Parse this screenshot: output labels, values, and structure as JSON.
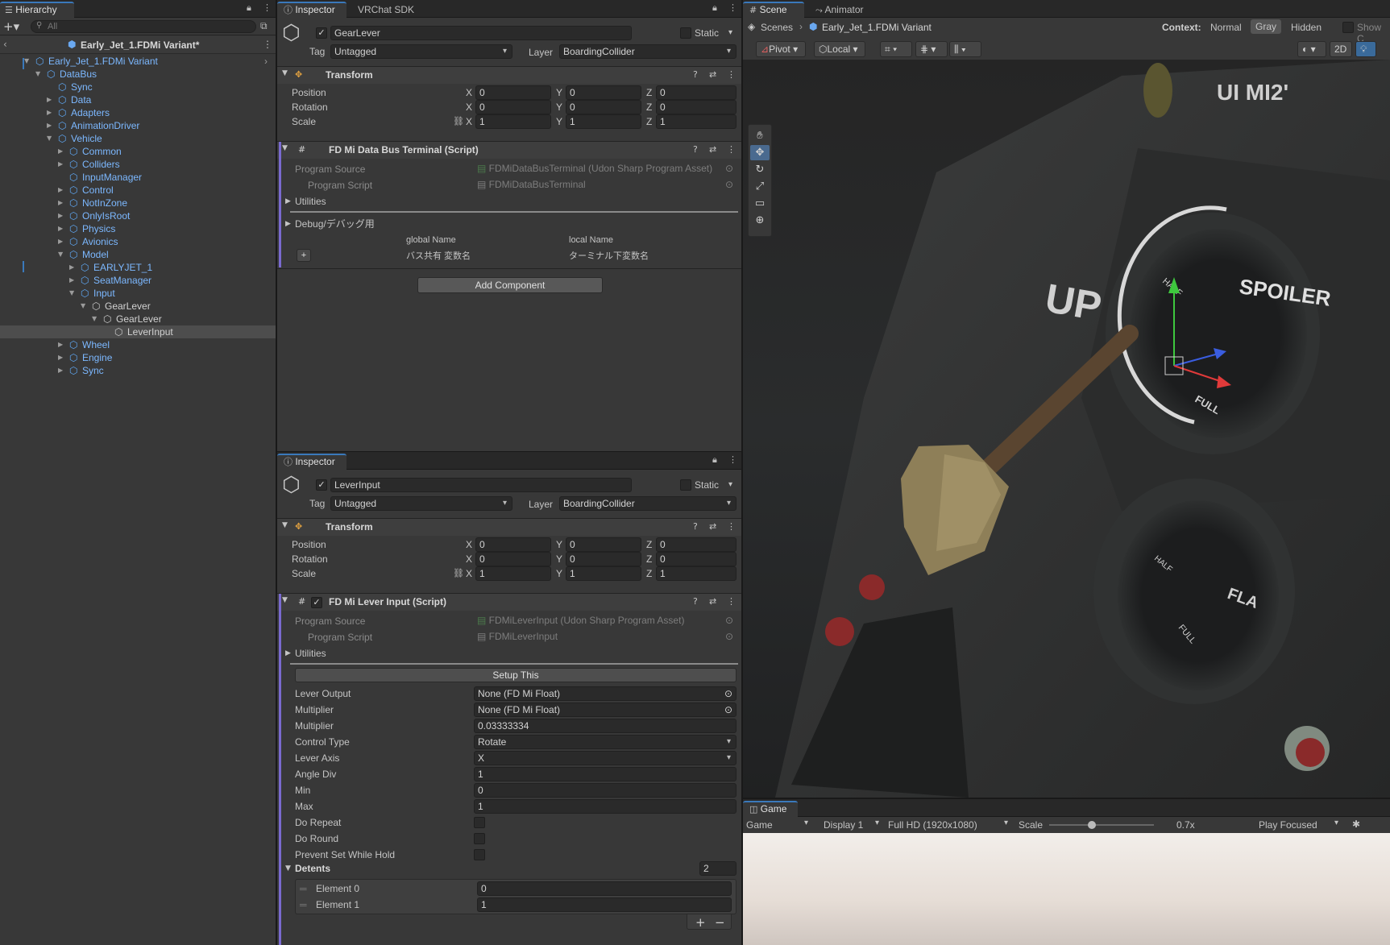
{
  "hierarchy": {
    "tab_label": "Hierarchy",
    "search_placeholder": "All",
    "scene_header": "Early_Jet_1.FDMi Variant*",
    "items": [
      {
        "label": "Early_Jet_1.FDMi Variant",
        "depth": 0,
        "arrow": "expanded",
        "style": "blue"
      },
      {
        "label": "DataBus",
        "depth": 1,
        "arrow": "expanded",
        "style": "blue"
      },
      {
        "label": "Sync",
        "depth": 2,
        "arrow": "none",
        "style": "blue"
      },
      {
        "label": "Data",
        "depth": 2,
        "arrow": "collapsed",
        "style": "blue"
      },
      {
        "label": "Adapters",
        "depth": 2,
        "arrow": "collapsed",
        "style": "blue"
      },
      {
        "label": "AnimationDriver",
        "depth": 2,
        "arrow": "collapsed",
        "style": "blue"
      },
      {
        "label": "Vehicle",
        "depth": 2,
        "arrow": "expanded",
        "style": "blue"
      },
      {
        "label": "Common",
        "depth": 3,
        "arrow": "collapsed",
        "style": "blue"
      },
      {
        "label": "Colliders",
        "depth": 3,
        "arrow": "collapsed",
        "style": "blue"
      },
      {
        "label": "InputManager",
        "depth": 3,
        "arrow": "none",
        "style": "blue"
      },
      {
        "label": "Control",
        "depth": 3,
        "arrow": "collapsed",
        "style": "blue"
      },
      {
        "label": "NotInZone",
        "depth": 3,
        "arrow": "collapsed",
        "style": "blue"
      },
      {
        "label": "OnlyIsRoot",
        "depth": 3,
        "arrow": "collapsed",
        "style": "blue"
      },
      {
        "label": "Physics",
        "depth": 3,
        "arrow": "collapsed",
        "style": "blue"
      },
      {
        "label": "Avionics",
        "depth": 3,
        "arrow": "collapsed",
        "style": "blue"
      },
      {
        "label": "Model",
        "depth": 3,
        "arrow": "expanded",
        "style": "blue"
      },
      {
        "label": "EARLYJET_1",
        "depth": 4,
        "arrow": "collapsed",
        "style": "blue"
      },
      {
        "label": "SeatManager",
        "depth": 4,
        "arrow": "collapsed",
        "style": "blue"
      },
      {
        "label": "Input",
        "depth": 4,
        "arrow": "expanded",
        "style": "blue"
      },
      {
        "label": "GearLever",
        "depth": 5,
        "arrow": "expanded",
        "style": "white"
      },
      {
        "label": "GearLever",
        "depth": 6,
        "arrow": "expanded",
        "style": "white"
      },
      {
        "label": "LeverInput",
        "depth": 7,
        "arrow": "none",
        "style": "white"
      },
      {
        "label": "Wheel",
        "depth": 3,
        "arrow": "collapsed",
        "style": "blue"
      },
      {
        "label": "Engine",
        "depth": 3,
        "arrow": "collapsed",
        "style": "blue"
      },
      {
        "label": "Sync",
        "depth": 3,
        "arrow": "collapsed",
        "style": "blue"
      }
    ]
  },
  "inspector_top": {
    "tabs": [
      "Inspector",
      "VRChat SDK"
    ],
    "object_name": "GearLever",
    "static_label": "Static",
    "tag_label": "Tag",
    "tag_value": "Untagged",
    "layer_label": "Layer",
    "layer_value": "BoardingCollider",
    "transform": {
      "title": "Transform",
      "position_label": "Position",
      "position": [
        "0",
        "0",
        "0"
      ],
      "rotation_label": "Rotation",
      "rotation": [
        "0",
        "0",
        "0"
      ],
      "scale_label": "Scale",
      "scale": [
        "1",
        "1",
        "1"
      ]
    },
    "script": {
      "title": "FD Mi Data Bus Terminal (Script)",
      "program_source_label": "Program Source",
      "program_source_value": "FDMiDataBusTerminal (Udon Sharp Program Asset)",
      "program_script_label": "Program Script",
      "program_script_value": "FDMiDataBusTerminal",
      "utilities_label": "Utilities",
      "debug_label": "Debug/デバッグ用",
      "col_global": "global Name",
      "col_local": "local Name",
      "row_global": "バス共有 変数名",
      "row_local": "ターミナル下変数名"
    },
    "add_component": "Add Component"
  },
  "inspector_bottom": {
    "tab": "Inspector",
    "object_name": "LeverInput",
    "static_label": "Static",
    "tag_label": "Tag",
    "tag_value": "Untagged",
    "layer_label": "Layer",
    "layer_value": "BoardingCollider",
    "transform": {
      "title": "Transform",
      "position_label": "Position",
      "position": [
        "0",
        "0",
        "0"
      ],
      "rotation_label": "Rotation",
      "rotation": [
        "0",
        "0",
        "0"
      ],
      "scale_label": "Scale",
      "scale": [
        "1",
        "1",
        "1"
      ]
    },
    "script": {
      "title": "FD Mi Lever Input (Script)",
      "program_source_label": "Program Source",
      "program_source_value": "FDMiLeverInput (Udon Sharp Program Asset)",
      "program_script_label": "Program Script",
      "program_script_value": "FDMiLeverInput",
      "utilities_label": "Utilities",
      "setup_button": "Setup This",
      "props": [
        {
          "label": "Lever Output",
          "value": "None (FD Mi Float)",
          "kind": "object"
        },
        {
          "label": "Multiplier",
          "value": "None (FD Mi Float)",
          "kind": "object"
        },
        {
          "label": "Multiplier",
          "value": "0.03333334",
          "kind": "text"
        },
        {
          "label": "Control Type",
          "value": "Rotate",
          "kind": "dropdown"
        },
        {
          "label": "Lever Axis",
          "value": "X",
          "kind": "dropdown"
        },
        {
          "label": "Angle Div",
          "value": "1",
          "kind": "text"
        },
        {
          "label": "Min",
          "value": "0",
          "kind": "text"
        },
        {
          "label": "Max",
          "value": "1",
          "kind": "text"
        },
        {
          "label": "Do Repeat",
          "value": "",
          "kind": "checkbox"
        },
        {
          "label": "Do Round",
          "value": "",
          "kind": "checkbox"
        },
        {
          "label": "Prevent Set While Hold",
          "value": "",
          "kind": "checkbox"
        }
      ],
      "detents_label": "Detents",
      "detents_count": "2",
      "detents": [
        {
          "label": "Element 0",
          "value": "0"
        },
        {
          "label": "Element 1",
          "value": "1"
        }
      ]
    }
  },
  "scene": {
    "tabs": [
      "Scene",
      "Animator"
    ],
    "breadcrumb_root": "Scenes",
    "breadcrumb_item": "Early_Jet_1.FDMi Variant",
    "context_label": "Context:",
    "context_options": [
      "Normal",
      "Gray",
      "Hidden"
    ],
    "show_label": "Show C",
    "pivot": "Pivot",
    "local": "Local",
    "btn_2d": "2D",
    "panel_labels": [
      "UP",
      "SPOILER",
      "HALF",
      "FULL",
      "FLA",
      "HALF",
      "FULL"
    ]
  },
  "game": {
    "tab": "Game",
    "mode": "Game",
    "display": "Display 1",
    "resolution": "Full HD (1920x1080)",
    "scale_label": "Scale",
    "scale_value": "0.7x",
    "play_mode": "Play Focused"
  }
}
